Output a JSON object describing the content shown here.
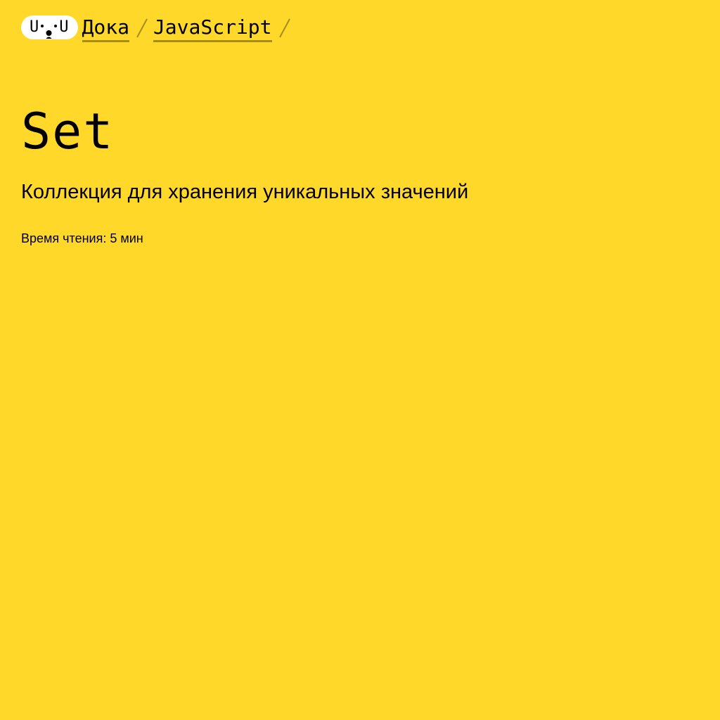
{
  "colors": {
    "background": "#FFD829",
    "logo_background": "#FFFFFF",
    "text": "#000000"
  },
  "header": {
    "logo_text_left": "U",
    "logo_text_right": "U",
    "breadcrumbs": [
      {
        "label": "Дока"
      },
      {
        "label": "JavaScript"
      }
    ]
  },
  "article": {
    "title": "Set",
    "subtitle": "Коллекция для хранения уникальных значений",
    "reading_time": "Время чтения: 5 мин"
  }
}
